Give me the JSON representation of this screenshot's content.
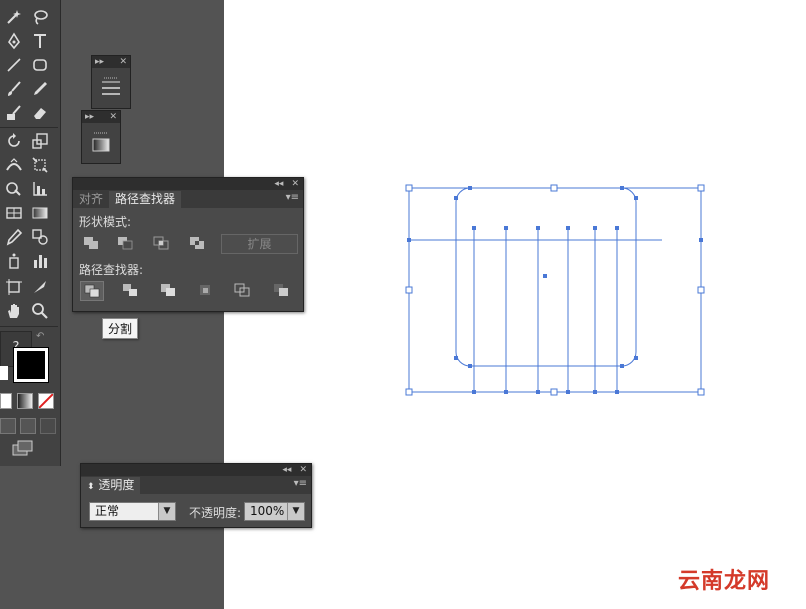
{
  "colors": {
    "selection": "#4a78d6",
    "panel_bg": "#444444",
    "workspace": "#535353",
    "artboard": "#ffffff"
  },
  "toolbar": {
    "tools": [
      "magic-wand-icon",
      "lasso-icon",
      "pen-icon",
      "type-icon",
      "line-icon",
      "rectangle-icon",
      "paintbrush-icon",
      "pencil-icon",
      "blob-brush-icon",
      "eraser-icon",
      "rotate-icon",
      "scale-icon",
      "width-icon",
      "free-transform-icon",
      "shape-builder-icon",
      "graph-icon",
      "mesh-icon",
      "gradient-icon",
      "eyedropper-icon",
      "blend-icon",
      "symbol-sprayer-icon",
      "column-graph-icon",
      "artboard-icon",
      "slice-icon",
      "hand-icon",
      "zoom-icon"
    ],
    "help_label": "?"
  },
  "pathfinder_panel": {
    "tabs": [
      {
        "label": "对齐"
      },
      {
        "label": "路径查找器"
      }
    ],
    "shape_modes_label": "形状模式:",
    "expand_label": "扩展",
    "pathfinders_label": "路径查找器:",
    "tooltip": "分割"
  },
  "transparency_panel": {
    "tab_label": "透明度",
    "blend_mode": "正常",
    "opacity_label": "不透明度:",
    "opacity_value": "100%"
  },
  "watermark": "云南龙网"
}
